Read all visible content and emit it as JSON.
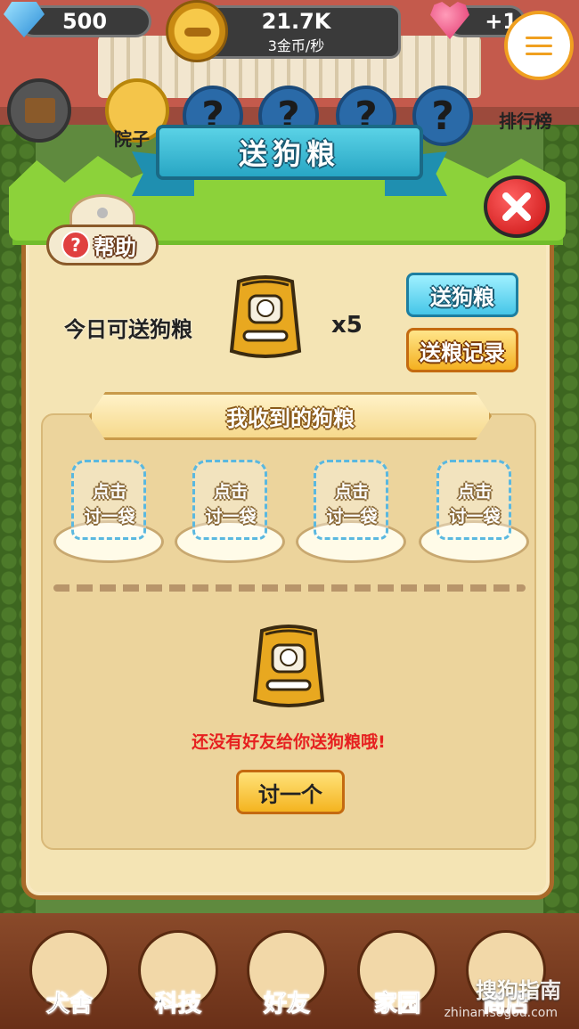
{
  "hud": {
    "gems": "500",
    "coins": "21.7K",
    "coin_rate": "3金币/秒",
    "hearts": "+1",
    "rank_label": "排行榜",
    "house_label": "院子",
    "unknown_slot": "?"
  },
  "modal": {
    "title": "送狗粮",
    "help_label": "帮助",
    "help_glyph": "?",
    "today_label": "今日可送狗粮",
    "multiplier": "x5",
    "send_button": "送狗粮",
    "record_button": "送粮记录",
    "received_title": "我收到的狗粮",
    "slots": [
      {
        "label": "点击\n讨一袋"
      },
      {
        "label": "点击\n讨一袋"
      },
      {
        "label": "点击\n讨一袋"
      },
      {
        "label": "点击\n讨一袋"
      }
    ],
    "empty_message": "还没有好友给你送狗粮哦!",
    "ask_button": "讨一个"
  },
  "bottom_nav": {
    "items": [
      {
        "label": "犬舍"
      },
      {
        "label": "科技"
      },
      {
        "label": "好友"
      },
      {
        "label": "家园"
      },
      {
        "label": "商店"
      }
    ]
  },
  "watermark": {
    "brand": "搜狗指南",
    "url": "zhinan.sogou.com"
  },
  "colors": {
    "title_ribbon": "#28a6c4",
    "close_button": "#c81010",
    "send_button": "#46c6e8",
    "record_button": "#f4b020",
    "empty_message": "#e62020"
  }
}
